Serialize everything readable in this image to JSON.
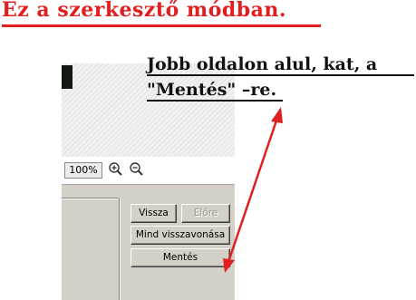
{
  "header": {
    "title": "Ez a szerkesztő módban."
  },
  "annotation": {
    "line1": "Jobb oldalon alul, kat, a",
    "line2": "\"Mentés\" –re."
  },
  "zoom": {
    "value": "100%",
    "zoom_in_icon": "zoom-in-icon",
    "zoom_out_icon": "zoom-out-icon"
  },
  "buttons": {
    "back": "Vissza",
    "forward": "Előre",
    "undo_all": "Mind visszavonása",
    "save": "Mentés"
  },
  "colors": {
    "title": "#e02020",
    "arrow": "#e02020",
    "panel": "#d4d0c8"
  }
}
